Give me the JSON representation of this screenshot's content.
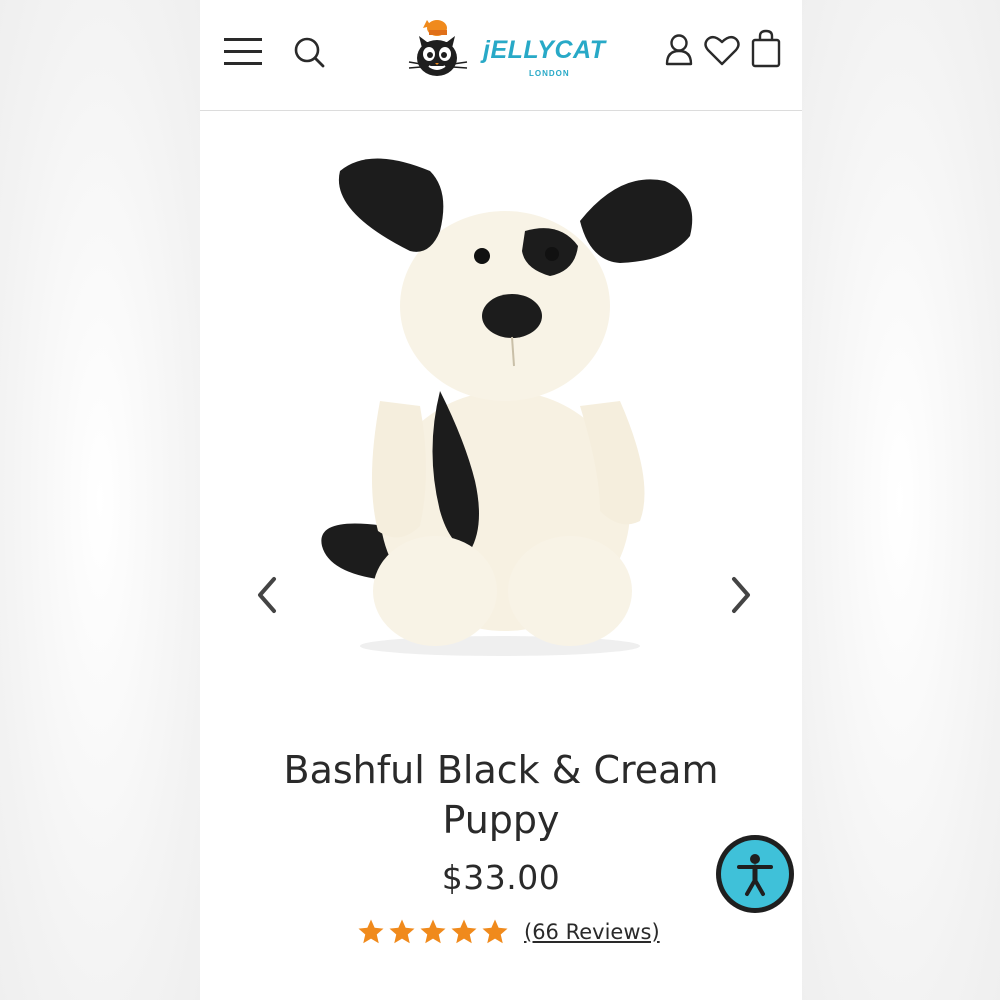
{
  "brand": {
    "name": "jELLYCAT",
    "sub": "LONDON",
    "accent_color": "#28a9c7",
    "icon": "cat-logo-icon"
  },
  "header": {
    "icons": [
      "menu-icon",
      "search-icon",
      "account-icon",
      "heart-icon",
      "bag-icon"
    ]
  },
  "product": {
    "title": "Bashful Black & Cream Puppy",
    "price": "$33.00",
    "rating": 5,
    "rating_max": 5,
    "reviews_label": "(66 Reviews)",
    "star_color": "#f08a1c"
  },
  "carousel": {
    "prev_icon": "chevron-left-icon",
    "next_icon": "chevron-right-icon"
  },
  "accessibility": {
    "icon": "accessibility-icon",
    "color": "#3fc1d9"
  }
}
